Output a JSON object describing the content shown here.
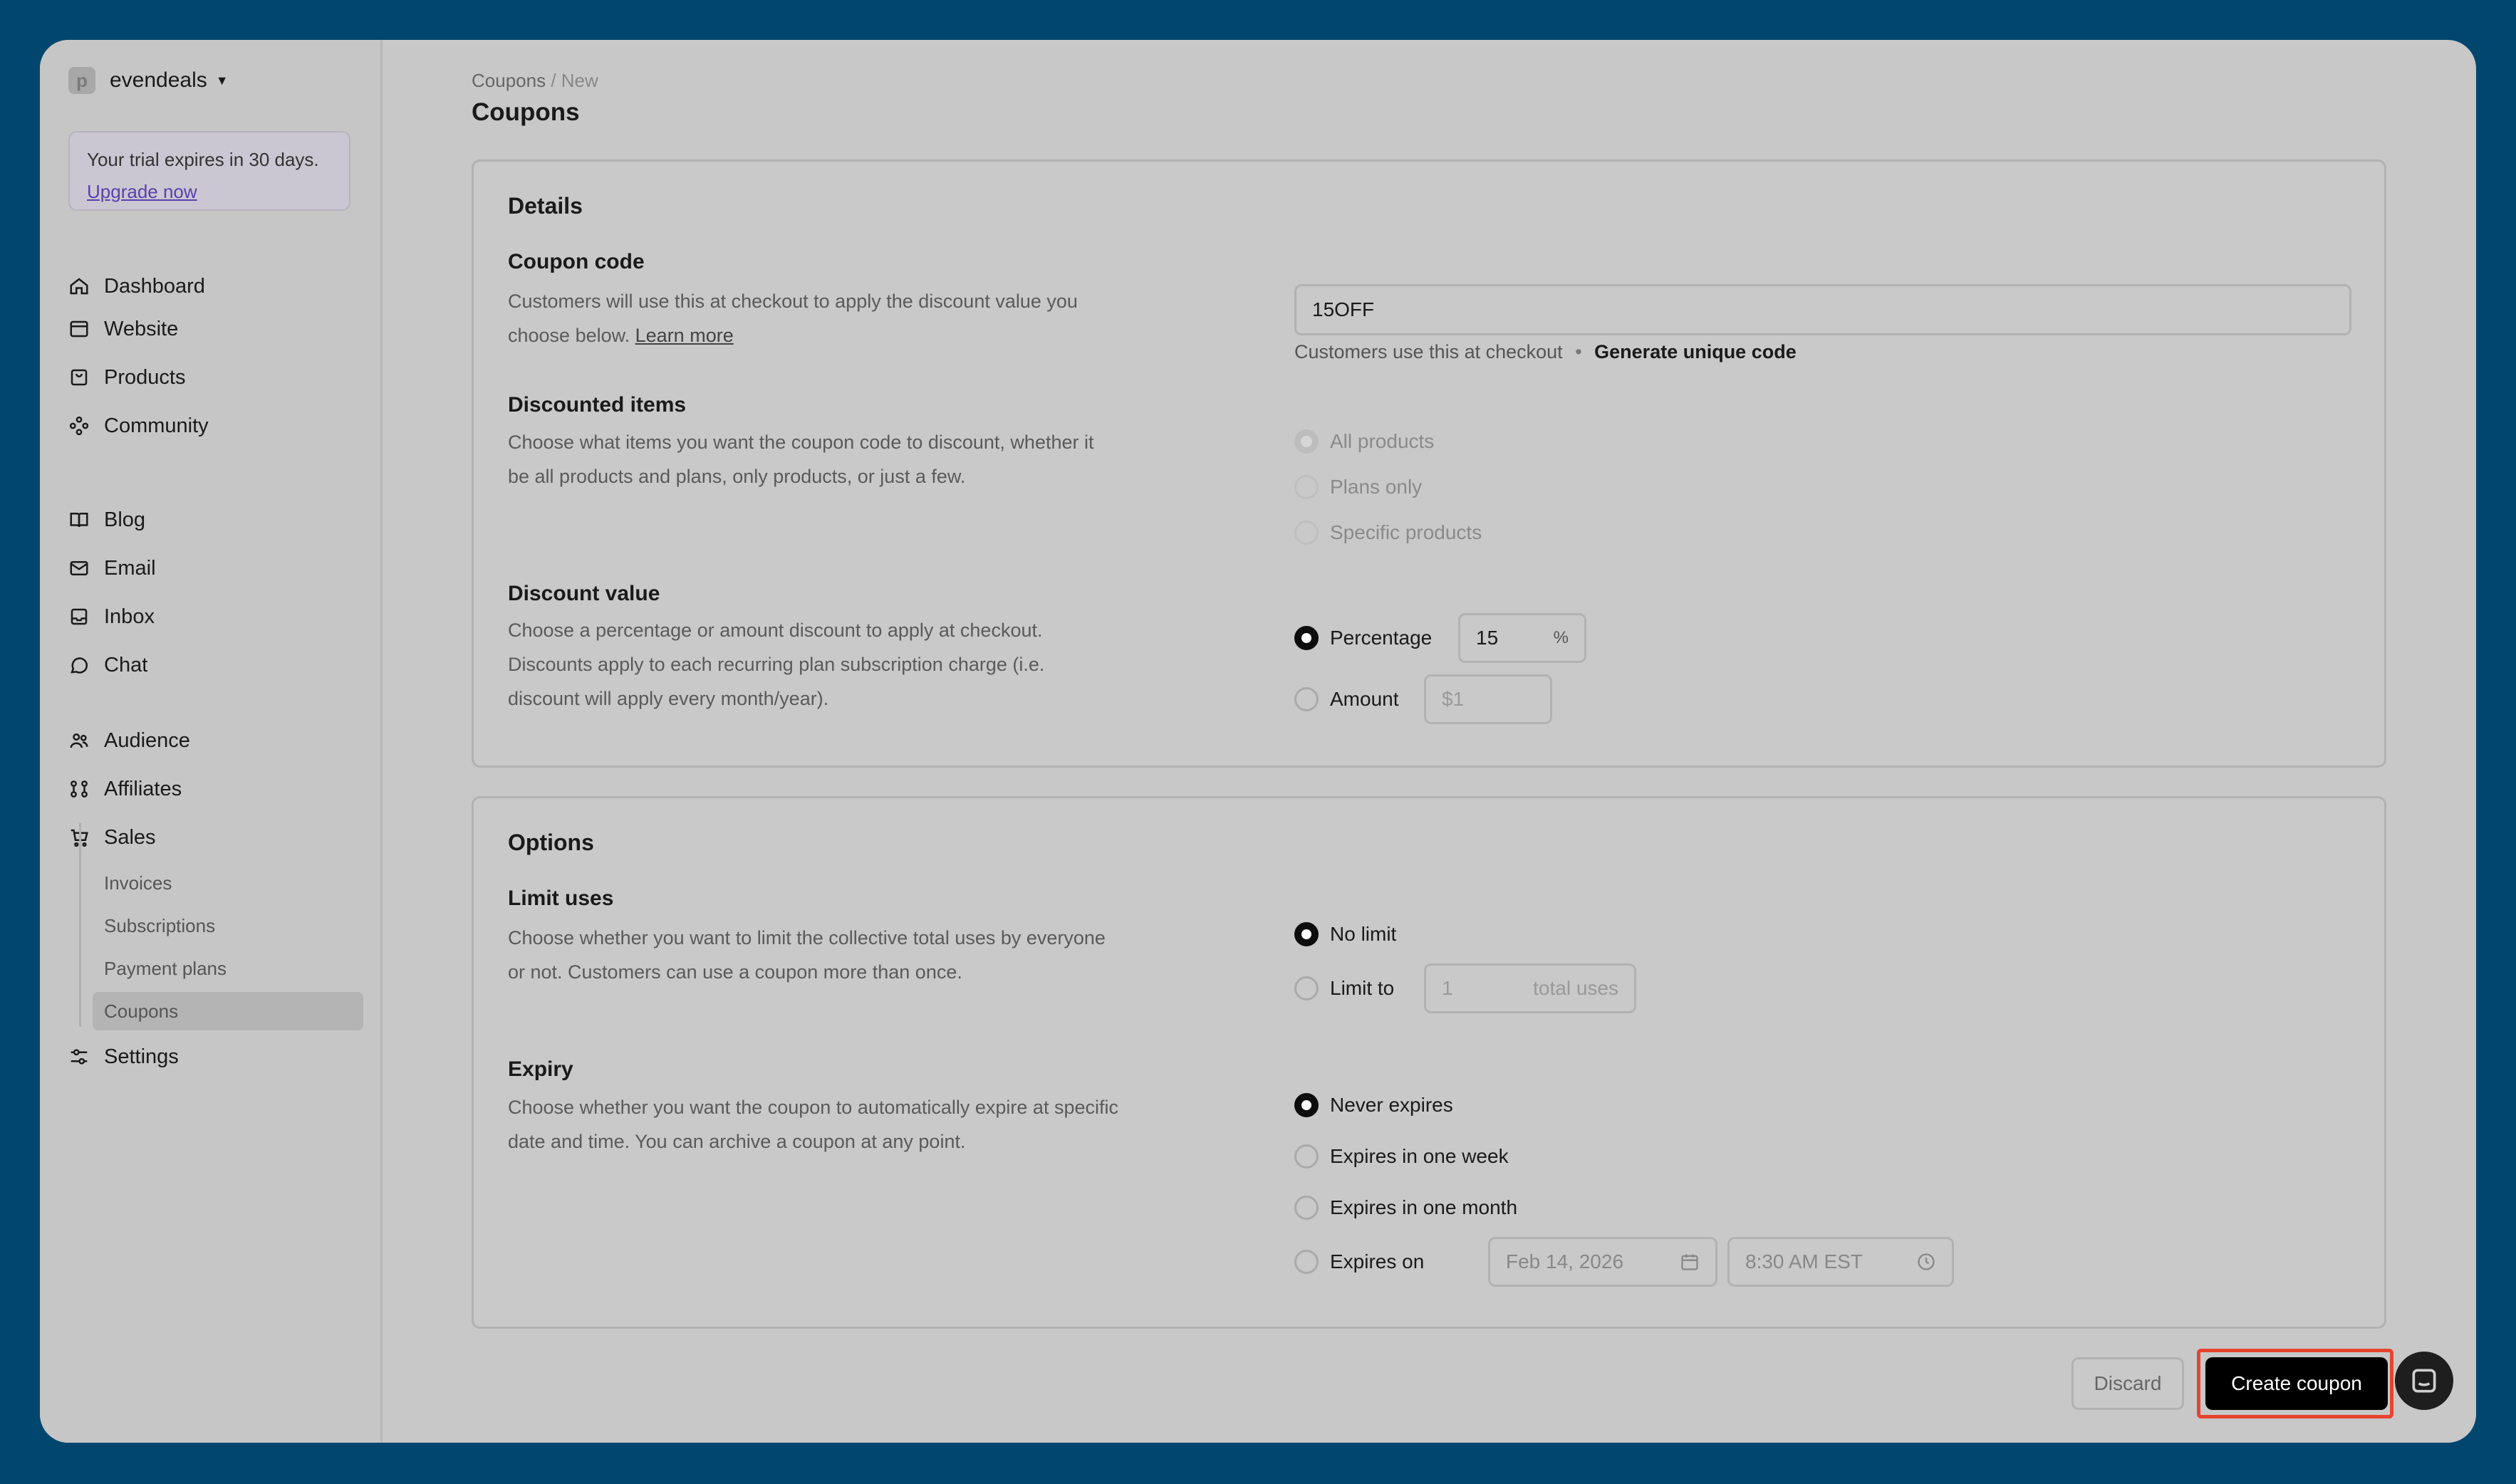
{
  "workspace": {
    "name": "evendeals",
    "logo_letter": "p"
  },
  "trial": {
    "text": "Your trial expires in 30 days.",
    "link": "Upgrade now"
  },
  "nav": [
    {
      "label": "Dashboard",
      "icon": "home-icon"
    },
    {
      "label": "Website",
      "icon": "browser-icon"
    },
    {
      "label": "Products",
      "icon": "bag-icon"
    },
    {
      "label": "Community",
      "icon": "community-icon"
    },
    {
      "label": "Blog",
      "icon": "book-icon"
    },
    {
      "label": "Email",
      "icon": "mail-icon"
    },
    {
      "label": "Inbox",
      "icon": "inbox-icon"
    },
    {
      "label": "Chat",
      "icon": "chat-icon"
    },
    {
      "label": "Audience",
      "icon": "users-icon"
    },
    {
      "label": "Affiliates",
      "icon": "affiliates-icon"
    },
    {
      "label": "Sales",
      "icon": "cart-icon"
    },
    {
      "label": "Settings",
      "icon": "sliders-icon"
    }
  ],
  "sales_sub": [
    "Invoices",
    "Subscriptions",
    "Payment plans",
    "Coupons"
  ],
  "breadcrumb": {
    "parent": "Coupons",
    "separator": "/",
    "current": "New"
  },
  "page_title": "Coupons",
  "details": {
    "title": "Details",
    "coupon_code": {
      "title": "Coupon code",
      "desc": "Customers will use this at checkout to apply the discount value you choose below.",
      "learn_more": "Learn more",
      "value": "15OFF",
      "helper": "Customers use this at checkout",
      "helper_sep": "•",
      "generate": "Generate unique code"
    },
    "discounted_items": {
      "title": "Discounted items",
      "desc": "Choose what items you want the coupon code to discount, whether it be all products and plans, only products, or just a few.",
      "options": [
        "All products",
        "Plans only",
        "Specific products"
      ]
    },
    "discount_value": {
      "title": "Discount value",
      "desc": "Choose a percentage or amount discount to apply at checkout. Discounts apply to each recurring plan subscription charge (i.e. discount will apply every month/year).",
      "percentage_label": "Percentage",
      "percentage_value": "15",
      "percentage_suffix": "%",
      "amount_label": "Amount",
      "amount_placeholder": "$1"
    }
  },
  "options": {
    "title": "Options",
    "limit_uses": {
      "title": "Limit uses",
      "desc": "Choose whether you want to limit the collective total uses by everyone or not. Customers can use a coupon more than once.",
      "no_limit": "No limit",
      "limit_to": "Limit to",
      "limit_placeholder": "1",
      "limit_suffix": "total uses"
    },
    "expiry": {
      "title": "Expiry",
      "desc": "Choose whether you want the coupon to automatically expire at specific date and time. You can archive a coupon at any point.",
      "never": "Never expires",
      "week": "Expires in one week",
      "month": "Expires in one month",
      "on": "Expires on",
      "date": "Feb 14, 2026",
      "time": "8:30 AM EST"
    }
  },
  "actions": {
    "discard": "Discard",
    "create": "Create coupon"
  }
}
